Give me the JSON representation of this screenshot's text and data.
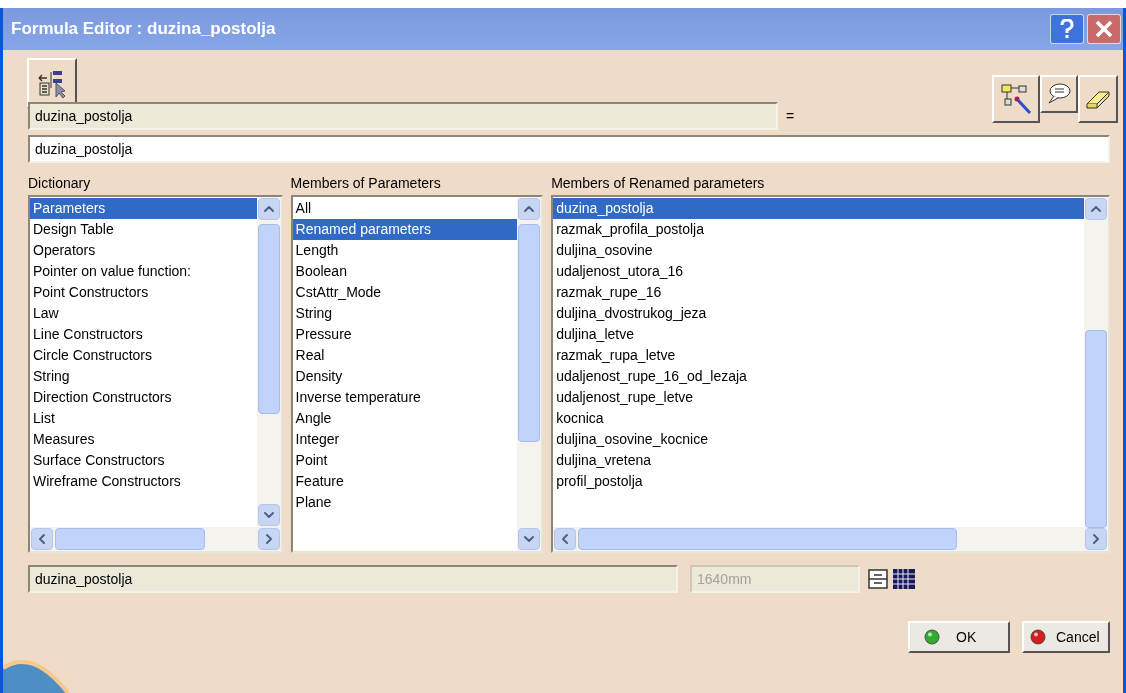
{
  "window": {
    "title": "Formula Editor : duzina_postolja"
  },
  "parameter_field": {
    "value": "duzina_postolja"
  },
  "equals_sign": "=",
  "formula_field": {
    "value": "duzina_postolja"
  },
  "lists": [
    {
      "label": "Dictionary",
      "items": [
        {
          "text": "Parameters",
          "selected": true
        },
        {
          "text": "Design Table",
          "selected": false
        },
        {
          "text": "Operators",
          "selected": false
        },
        {
          "text": "Pointer on value function:",
          "selected": false
        },
        {
          "text": "Point Constructors",
          "selected": false
        },
        {
          "text": "Law",
          "selected": false
        },
        {
          "text": "Line Constructors",
          "selected": false
        },
        {
          "text": "Circle Constructors",
          "selected": false
        },
        {
          "text": "String",
          "selected": false
        },
        {
          "text": "Direction Constructors",
          "selected": false
        },
        {
          "text": "List",
          "selected": false
        },
        {
          "text": "Measures",
          "selected": false
        },
        {
          "text": "Surface Constructors",
          "selected": false
        },
        {
          "text": "Wireframe Constructors",
          "selected": false
        }
      ]
    },
    {
      "label": "Members of Parameters",
      "items": [
        {
          "text": "All",
          "selected": false
        },
        {
          "text": "Renamed parameters",
          "selected": true
        },
        {
          "text": "Length",
          "selected": false
        },
        {
          "text": "Boolean",
          "selected": false
        },
        {
          "text": "CstAttr_Mode",
          "selected": false
        },
        {
          "text": "String",
          "selected": false
        },
        {
          "text": "Pressure",
          "selected": false
        },
        {
          "text": "Real",
          "selected": false
        },
        {
          "text": "Density",
          "selected": false
        },
        {
          "text": "Inverse temperature",
          "selected": false
        },
        {
          "text": "Angle",
          "selected": false
        },
        {
          "text": "Integer",
          "selected": false
        },
        {
          "text": "Point",
          "selected": false
        },
        {
          "text": "Feature",
          "selected": false
        },
        {
          "text": "Plane",
          "selected": false
        }
      ]
    },
    {
      "label": "Members of Renamed parameters",
      "items": [
        {
          "text": "duzina_postolja",
          "selected": true
        },
        {
          "text": "razmak_profila_postolja",
          "selected": false
        },
        {
          "text": "duljina_osovine",
          "selected": false
        },
        {
          "text": "udaljenost_utora_16",
          "selected": false
        },
        {
          "text": "razmak_rupe_16",
          "selected": false
        },
        {
          "text": "duljina_dvostrukog_jeza",
          "selected": false
        },
        {
          "text": "duljina_letve",
          "selected": false
        },
        {
          "text": "razmak_rupa_letve",
          "selected": false
        },
        {
          "text": "udaljenost_rupe_16_od_lezaja",
          "selected": false
        },
        {
          "text": "udaljenost_rupe_letve",
          "selected": false
        },
        {
          "text": "kocnica",
          "selected": false
        },
        {
          "text": "duljina_osovine_kocnice",
          "selected": false
        },
        {
          "text": "duljina_vretena",
          "selected": false
        },
        {
          "text": "profil_postolja",
          "selected": false
        }
      ]
    }
  ],
  "value_field": {
    "value": "duzina_postolja"
  },
  "measure_field": {
    "value": "1640mm",
    "disabled": true
  },
  "buttons": [
    {
      "label": "OK",
      "kind": "ok"
    },
    {
      "label": "Cancel",
      "kind": "cancel"
    }
  ]
}
